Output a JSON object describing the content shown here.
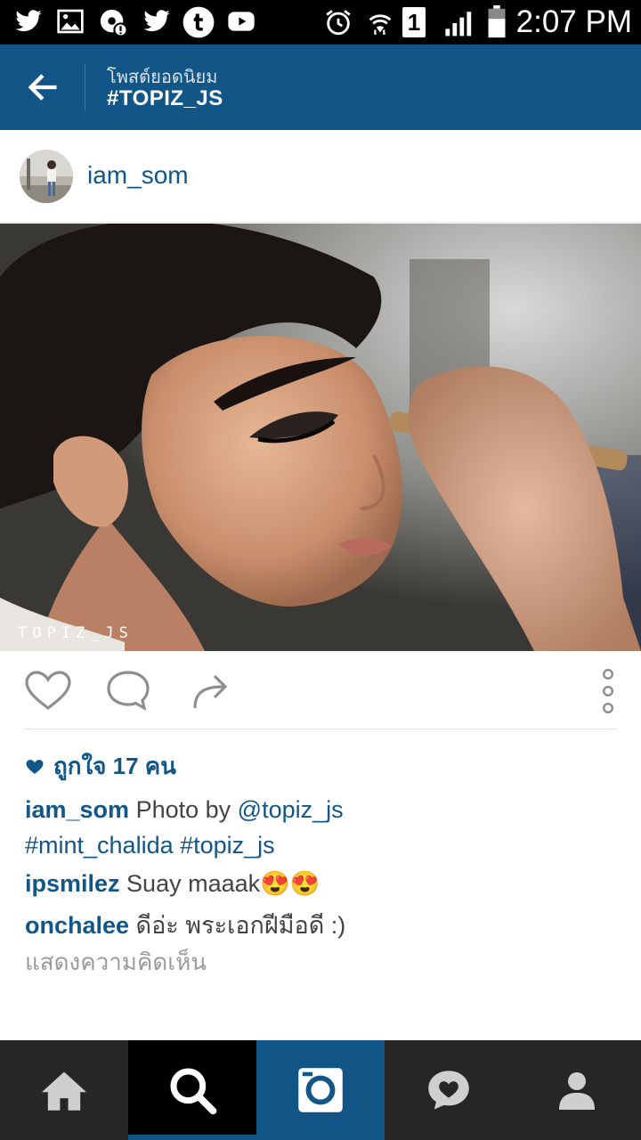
{
  "status_bar": {
    "time": "2:07 PM",
    "left_icons": [
      "twitter-icon",
      "image-icon",
      "alert-settings-icon",
      "twitter-icon",
      "tumblr-icon",
      "youtube-icon"
    ],
    "right_icons": [
      "alarm-icon",
      "wifi-icon",
      "sim-icon",
      "signal-icon",
      "battery-icon"
    ],
    "sim_label": "1"
  },
  "app_bar": {
    "subtitle": "โพสต์ยอดนิยม",
    "title": "#TOPIZ_JS"
  },
  "post": {
    "username": "iam_som",
    "watermark": "TOPIZ_JS",
    "likes_text": "ถูกใจ 17 คน",
    "caption": {
      "user": "iam_som",
      "text": " Photo by ",
      "mention": "@topiz_js",
      "hashtags": "#mint_chalida #topiz_js"
    },
    "comments": [
      {
        "user": "ipsmilez",
        "text": " Suay maaak😍😍"
      },
      {
        "user": "onchalee",
        "text": " ดีอ่ะ พระเอกฝีมือดี :)"
      }
    ],
    "view_comments": "แสดงความคิดเห็น"
  },
  "colors": {
    "brand": "#125688",
    "status_bar": "#000000",
    "nav_bg": "#262626",
    "muted": "#9a9a9a"
  },
  "bottom_nav": [
    "home-icon",
    "search-icon",
    "camera-icon",
    "activity-icon",
    "profile-icon"
  ]
}
